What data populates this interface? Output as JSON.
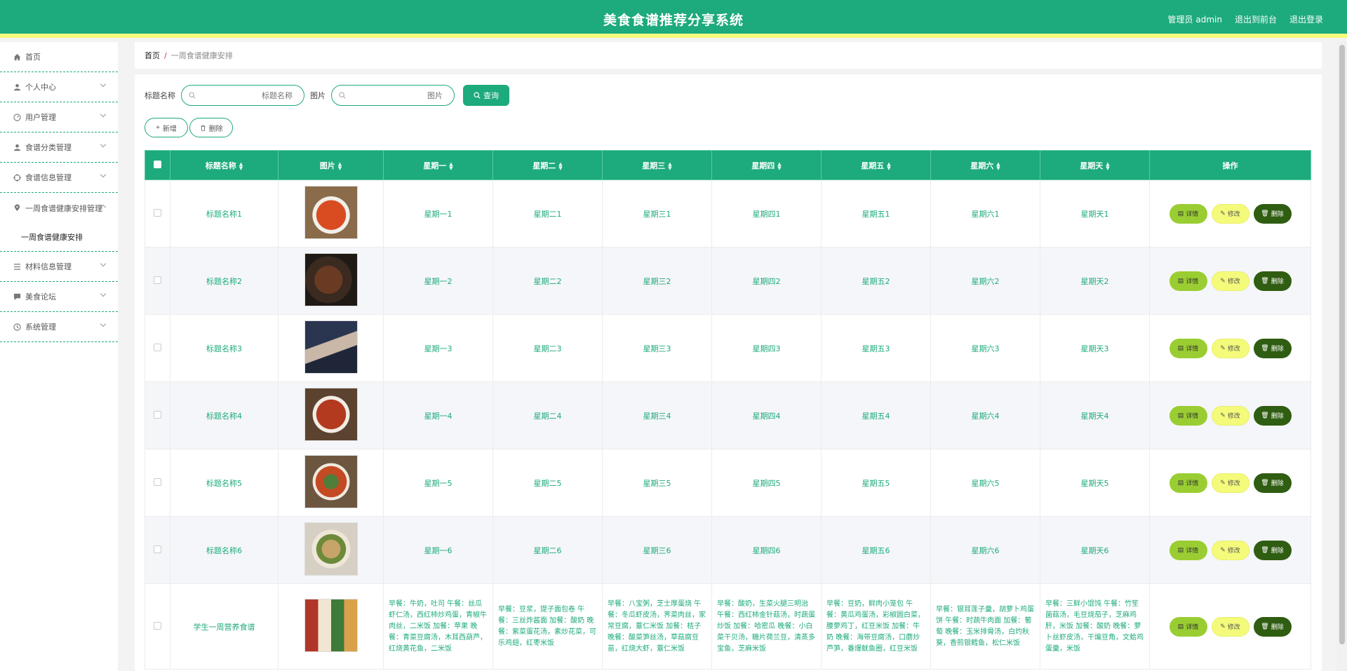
{
  "header": {
    "title": "美食食谱推荐分享系统",
    "admin": "管理员 admin",
    "front": "退出到前台",
    "logout": "退出登录"
  },
  "sidebar": {
    "items": [
      {
        "label": "首页",
        "icon": "home-icon",
        "expand": false
      },
      {
        "label": "个人中心",
        "icon": "user-icon",
        "expand": true
      },
      {
        "label": "用户管理",
        "icon": "dashboard-icon",
        "expand": true
      },
      {
        "label": "食谱分类管理",
        "icon": "user-icon",
        "expand": true
      },
      {
        "label": "食谱信息管理",
        "icon": "crosshair-icon",
        "expand": true
      },
      {
        "label": "一周食谱健康安排管理",
        "icon": "pin-icon",
        "expand": true,
        "open": true
      },
      {
        "label": "材料信息管理",
        "icon": "list-icon",
        "expand": true
      },
      {
        "label": "美食论坛",
        "icon": "chat-icon",
        "expand": true
      },
      {
        "label": "系统管理",
        "icon": "clock-icon",
        "expand": true
      }
    ],
    "submenu": "一周食谱健康安排"
  },
  "breadcrumb": {
    "home": "首页",
    "sep": "/",
    "current": "一周食谱健康安排"
  },
  "search": {
    "label1": "标题名称",
    "placeholder1": "标题名称",
    "label2": "图片",
    "placeholder2": "图片",
    "query": "查询"
  },
  "actions": {
    "add": "新增",
    "delete": "删除"
  },
  "table": {
    "headers": [
      "标题名称",
      "图片",
      "星期一",
      "星期二",
      "星期三",
      "星期四",
      "星期五",
      "星期六",
      "星期天",
      "操作"
    ],
    "rows": [
      {
        "title": "标题名称1",
        "d1": "星期一1",
        "d2": "星期二1",
        "d3": "星期三1",
        "d4": "星期四1",
        "d5": "星期五1",
        "d6": "星期六1",
        "d7": "星期天1"
      },
      {
        "title": "标题名称2",
        "d1": "星期一2",
        "d2": "星期二2",
        "d3": "星期三2",
        "d4": "星期四2",
        "d5": "星期五2",
        "d6": "星期六2",
        "d7": "星期天2"
      },
      {
        "title": "标题名称3",
        "d1": "星期一3",
        "d2": "星期二3",
        "d3": "星期三3",
        "d4": "星期四3",
        "d5": "星期五3",
        "d6": "星期六3",
        "d7": "星期天3"
      },
      {
        "title": "标题名称4",
        "d1": "星期一4",
        "d2": "星期二4",
        "d3": "星期三4",
        "d4": "星期四4",
        "d5": "星期五4",
        "d6": "星期六4",
        "d7": "星期天4"
      },
      {
        "title": "标题名称5",
        "d1": "星期一5",
        "d2": "星期二5",
        "d3": "星期三5",
        "d4": "星期四5",
        "d5": "星期五5",
        "d6": "星期六5",
        "d7": "星期天5"
      },
      {
        "title": "标题名称6",
        "d1": "星期一6",
        "d2": "星期二6",
        "d3": "星期三6",
        "d4": "星期四6",
        "d5": "星期五6",
        "d6": "星期六6",
        "d7": "星期天6"
      },
      {
        "title": "学生一周营养食谱",
        "d1": "早餐：牛奶，吐司 午餐：丝瓜虾仁汤，西红柿炒鸡蛋，青椒牛肉丝，二米饭 加餐：苹果 晚餐：青菜豆腐汤，木耳西葫芦，红烧黄花鱼，二米饭",
        "d2": "早餐：豆浆，提子面包卷 午餐：三丝炸酱面 加餐：酸奶 晚餐：紫菜蛋花汤，素炒花菜，可乐鸡翅，红枣米饭",
        "d3": "早餐：八宝粥，芝士厚蛋烧 午餐：冬瓜虾皮汤，荠菜肉丝，家常豆腐，薏仁米饭 加餐：桔子 晚餐：酸菜笋丝汤，草菇腐豆苗，红烧大虾，薏仁米饭",
        "d4": "早餐：酸奶，生菜火腿三明治 午餐：西红柿金针菇汤，时蔬蛋炒饭 加餐：哈密瓜 晚餐：小白菜干贝汤，糖片荷兰豆，清蒸多宝鱼，芝麻米饭",
        "d5": "早餐：豆奶，鲜肉小笼包 午餐：黄瓜鸡蛋汤，彩椒圆白菜，腰萝鸡丁，红豆米饭 加餐：牛奶 晚餐：海带豆腐汤，口蘑炒芦笋，番爆鱿鱼圈，红豆米饭",
        "d6": "早餐：银耳莲子羹，胡萝卜鸡蛋饼 午餐：时蔬牛肉面 加餐：葡萄 晚餐：玉米排骨汤，白灼秋葵，香煎银鳕鱼，松仁米饭",
        "d7": "早餐：三鲜小馄饨 午餐：竹笙菌菇汤，毛豆烧茄子，芝麻鸡肝，米饭 加餐：酸奶 晚餐：萝卜丝虾皮汤，干煸豆角，文蛤鸡蛋羹，米饭"
      }
    ],
    "ops": {
      "detail": "详情",
      "edit": "修改",
      "del": "删除"
    }
  },
  "colors": {
    "primary": "#1daa7c",
    "accent_yellow": "#f4fb7a",
    "detail_green": "#9acd32",
    "delete_dark": "#2f5d11"
  }
}
